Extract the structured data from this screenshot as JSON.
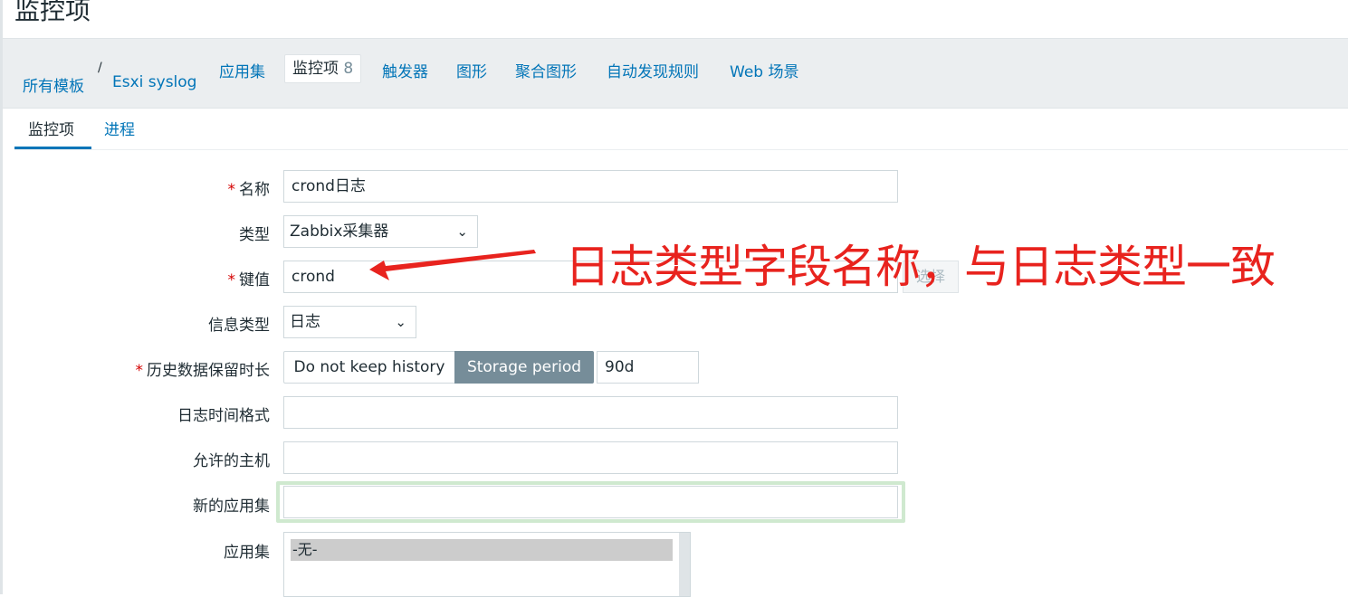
{
  "page": {
    "title": "监控项"
  },
  "breadcrumb": {
    "all_templates": "所有模板",
    "separator": "/",
    "template": "Esxi syslog"
  },
  "nav": {
    "applications": "应用集",
    "items_label": "监控项",
    "items_count": "8",
    "triggers": "触发器",
    "graphs": "图形",
    "screens": "聚合图形",
    "discovery": "自动发现规则",
    "web": "Web 场景"
  },
  "tabs": {
    "item": "监控项",
    "process": "进程"
  },
  "form": {
    "required_mark": "*",
    "name_label": "名称",
    "name_value": "crond日志",
    "type_label": "类型",
    "type_value": "Zabbix采集器",
    "key_label": "键值",
    "key_value": "crond",
    "select_button": "选择",
    "value_type_label": "信息类型",
    "value_type_value": "日志",
    "history_label": "历史数据保留时长",
    "history_opt_off": "Do not keep history",
    "history_opt_on": "Storage period",
    "history_value": "90d",
    "logtime_label": "日志时间格式",
    "logtime_value": "",
    "allowed_hosts_label": "允许的主机",
    "allowed_hosts_value": "",
    "new_app_label": "新的应用集",
    "new_app_value": "",
    "apps_label": "应用集",
    "apps_option": "-无-"
  },
  "annotation": {
    "text": "日志类型字段名称，与日志类型一致"
  },
  "colors": {
    "link": "#0275b8",
    "annotation": "#e8231e",
    "active_segment": "#768d99",
    "focus": "#cfe9cf"
  }
}
